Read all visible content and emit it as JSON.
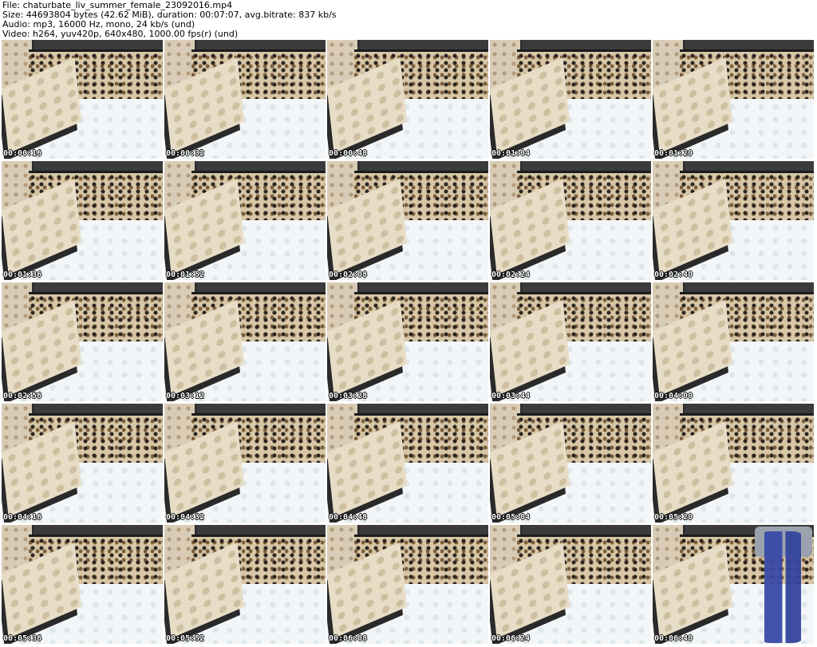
{
  "header": {
    "file": "File: chaturbate_liv_summer_female_23092016.mp4",
    "size": "Size: 44693804 bytes (42.62 MiB), duration: 00:07:07, avg.bitrate: 837 kb/s",
    "audio": "Audio: mp3, 16000 Hz, mono, 24 kb/s (und)",
    "video": "Video: h264, yuv420p, 640x480, 1000.00 fps(r) (und)"
  },
  "thumbnails": [
    {
      "time": "00:00:16"
    },
    {
      "time": "00:00:32"
    },
    {
      "time": "00:00:48"
    },
    {
      "time": "00:01:04"
    },
    {
      "time": "00:01:20"
    },
    {
      "time": "00:01:36"
    },
    {
      "time": "00:01:52"
    },
    {
      "time": "00:02:08"
    },
    {
      "time": "00:02:24"
    },
    {
      "time": "00:02:40"
    },
    {
      "time": "00:02:56"
    },
    {
      "time": "00:03:12"
    },
    {
      "time": "00:03:28"
    },
    {
      "time": "00:03:44"
    },
    {
      "time": "00:04:00"
    },
    {
      "time": "00:04:16"
    },
    {
      "time": "00:04:32"
    },
    {
      "time": "00:04:48"
    },
    {
      "time": "00:05:04"
    },
    {
      "time": "00:05:20"
    },
    {
      "time": "00:05:36"
    },
    {
      "time": "00:05:52"
    },
    {
      "time": "00:06:08"
    },
    {
      "time": "00:06:24"
    },
    {
      "time": "00:06:40"
    }
  ]
}
